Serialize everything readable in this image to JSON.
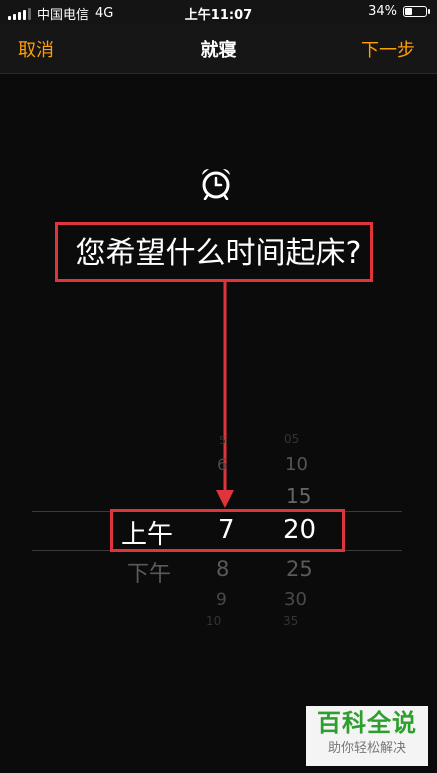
{
  "status_bar": {
    "carrier": "中国电信",
    "network": "4G",
    "time": "上午11:07",
    "battery_percent": "34%",
    "battery_level": 0.34
  },
  "nav": {
    "cancel_label": "取消",
    "title": "就寝",
    "next_label": "下一步",
    "accent_color": "#ff9f0a"
  },
  "question": "您希望什么时间起床?",
  "icons": [
    "alarm-clock-icon",
    "signal-icon",
    "battery-icon"
  ],
  "picker": {
    "ampm": {
      "selected": "上午",
      "below": "下午"
    },
    "hour": {
      "above": [
        "5",
        "6"
      ],
      "selected": "7",
      "below": [
        "8",
        "9",
        "10"
      ]
    },
    "minute": {
      "above": [
        "05",
        "10",
        "15"
      ],
      "selected": "20",
      "below": [
        "25",
        "30",
        "35"
      ]
    }
  },
  "highlight_color": "#e0343d",
  "watermark": {
    "title": "百科全说",
    "subtitle": "助你轻松解决"
  }
}
